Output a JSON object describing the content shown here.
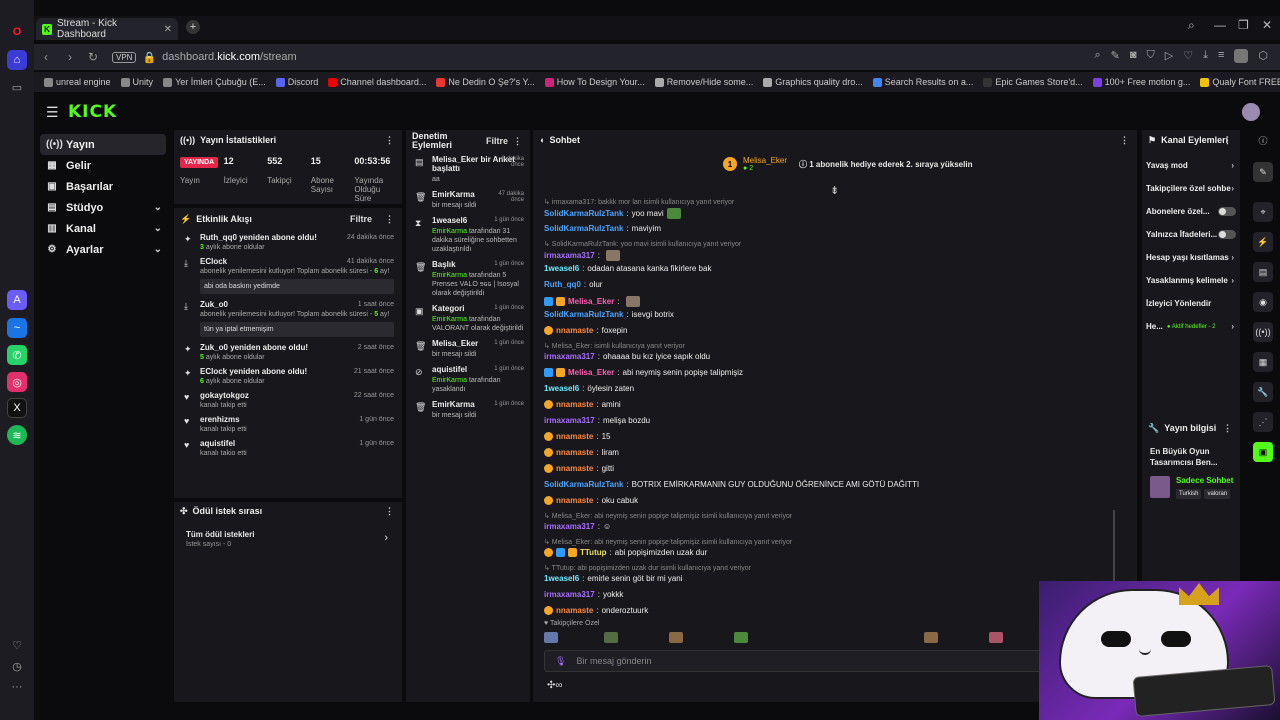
{
  "browser": {
    "tab_title": "Stream - Kick Dashboard",
    "url_host": "dashboard.",
    "url_domain": "kick.com",
    "url_path": "/stream",
    "vpn": "VPN",
    "bookmarks": [
      "unreal engine",
      "Unity",
      "Yer İmleri Çubuğu (E...",
      "Discord",
      "Channel dashboard...",
      "Ne Dedin O Şe?'s Y...",
      "How To Design Your...",
      "Remove/Hide some...",
      "Graphics quality dro...",
      "Search Results on a...",
      "Epic Games Store'd...",
      "100+ Free motion g...",
      "Qualy Font FREE Do..."
    ],
    "bookmark_colors": [
      "#888",
      "#888",
      "#888",
      "#5865f2",
      "#e00",
      "#e33",
      "#d0237a",
      "#aaa",
      "#aaa",
      "#4285f4",
      "#333",
      "#7b3fe4",
      "#f0c300"
    ]
  },
  "app": {
    "logo": "KICK",
    "nav": [
      {
        "label": "Yayın",
        "icon": "((•))",
        "active": true
      },
      {
        "label": "Gelir",
        "icon": "▦"
      },
      {
        "label": "Başarılar",
        "icon": "▣"
      },
      {
        "label": "Stüdyo",
        "icon": "▤",
        "chev": "⌄"
      },
      {
        "label": "Kanal",
        "icon": "▥",
        "chev": "⌄"
      },
      {
        "label": "Ayarlar",
        "icon": "⚙",
        "chev": "⌄"
      }
    ]
  },
  "stats": {
    "title": "Yayın İstatistikleri",
    "live": "YAYINDA",
    "items": [
      {
        "label": "Yayın",
        "value": ""
      },
      {
        "label": "İzleyici",
        "value": "12"
      },
      {
        "label": "Takipçi",
        "value": "552"
      },
      {
        "label": "Abone Sayısı",
        "value": "15"
      },
      {
        "label": "Yayında Olduğu Süre",
        "value": "00:53:56"
      }
    ]
  },
  "activity": {
    "title": "Etkinlik Akışı",
    "filter": "Filtre",
    "events": [
      {
        "title": "Ruth_qq0 yeniden abone oldu!",
        "time": "24 dakika önce",
        "sub": "3",
        "subrest": " aylık abone oldular",
        "icon": "✦"
      },
      {
        "title": "EClock",
        "time": "41 dakika önce",
        "sub2": "abonelik yenilemesini kutluyor! Toplam abonelik süresi - ",
        "subnum": "6",
        "subend": " ay!",
        "msg": "abi oda baskını yedimde",
        "icon": "⤓"
      },
      {
        "title": "Zuk_o0",
        "time": "1 saat önce",
        "sub2": "abonelik yenilemesini kutluyor! Toplam abonelik süresi - ",
        "subnum": "5",
        "subend": " ay!",
        "msg": "tün ya iptal etmemişim",
        "icon": "⤓"
      },
      {
        "title": "Zuk_o0 yeniden abone oldu!",
        "time": "2 saat önce",
        "sub": "5",
        "subrest": " aylık abone oldular",
        "icon": "✦"
      },
      {
        "title": "EClock yeniden abone oldu!",
        "time": "21 saat önce",
        "sub": "6",
        "subrest": " aylık abone oldular",
        "icon": "✦"
      },
      {
        "title": "gokaytokgoz",
        "time": "22 saat önce",
        "plain": "kanalı takip etti",
        "icon": "♥"
      },
      {
        "title": "erenhizms",
        "time": "1 gün önce",
        "plain": "kanalı takip etti",
        "icon": "♥"
      },
      {
        "title": "aquistifel",
        "time": "1 gün önce",
        "plain": "kanalı takio etti",
        "icon": "♥"
      }
    ]
  },
  "rewards": {
    "title": "Ödül istek sırası",
    "all": "Tüm ödül istekleri",
    "count": "İstek sayısı - 0"
  },
  "moderation": {
    "title": "Denetim Eylemleri",
    "filter": "Filtre",
    "items": [
      {
        "icon": "▤",
        "title": "Melisa_Eker bir Anket başlattı",
        "time": "8 dakika önce",
        "sub": "aa",
        "g": true
      },
      {
        "icon": "🗑",
        "title": "EmirKarma",
        "time": "47 dakika önce",
        "sub": "bir mesajı sildi"
      },
      {
        "icon": "⧗",
        "title": "1weasel6",
        "time": "1 gün önce",
        "gname": "EmirKarma",
        "sub": " tarafından 31 dakika süreliğine sohbetten uzaklaştırıldı"
      },
      {
        "icon": "🗑",
        "title": "Başlık",
        "time": "1 gün önce",
        "gname": "EmirKarma",
        "sub": " tarafından 5 Prenses VALO ɘɢɢ | Isosyal olarak değiştirildi"
      },
      {
        "icon": "▣",
        "title": "Kategori",
        "time": "1 gün önce",
        "gname": "EmirKarma",
        "sub": " tarafından VALORANT olarak değiştirildi"
      },
      {
        "icon": "🗑",
        "title": "Melisa_Eker",
        "time": "1 gün önce",
        "sub": "bir mesajı sildi"
      },
      {
        "icon": "⊘",
        "title": "aquistifel",
        "time": "1 gün önce",
        "gname": "EmirKarma",
        "sub": " tarafından yasaklandı"
      },
      {
        "icon": "🗑",
        "title": "EmirKarma",
        "time": "1 gün önce",
        "sub": "bir mesajı sildi"
      }
    ]
  },
  "chat": {
    "title": "Sohbet",
    "pinned_user": "Melisa_Eker",
    "pinned_count": "2",
    "pinned_text": "1 abonelik hediye ederek 2. sıraya yükselin",
    "input_placeholder": "Bir mesaj gönderin",
    "followers_label": "Takipçilere Özel",
    "lines": [
      {
        "reply": "↳ irmaxama317: bakkk mor lan isimli kullanıcıya yanıt veriyor"
      },
      {
        "user": "SolidKarmaRulzTank",
        "cls": "u2",
        "text": "yoo mavi"
      },
      {
        "user": "SolidKarmaRulzTank",
        "cls": "u2",
        "text": "maviyim"
      },
      {
        "reply": "↳ SolidKarmaRulzTank: yoo mavi  isimli kullanıcıya yanıt veriyor"
      },
      {
        "user": "irmaxama317",
        "cls": "u1",
        "text": ""
      },
      {
        "user": "1weasel6",
        "cls": "u6",
        "text": "odadan atasana kanka fikirlere bak"
      },
      {
        "user": "Ruth_qq0",
        "cls": "u2",
        "text": "olur"
      },
      {
        "user": "Melisa_Eker",
        "cls": "u4",
        "text": ""
      },
      {
        "user": "SolidKarmaRulzTank",
        "cls": "u2",
        "text": "isevgi botrix"
      },
      {
        "user": "nnamaste",
        "cls": "u3",
        "text": "foxepin"
      },
      {
        "reply": "↳ Melisa_Eker:  isimli kullanıcıya yanıt veriyor"
      },
      {
        "user": "irmaxama317",
        "cls": "u1",
        "text": "ohaaaa bu kız iyice sapık oldu"
      },
      {
        "user": "Melisa_Eker",
        "cls": "u4",
        "text": "abi neymiş senin popişe talipmişiz"
      },
      {
        "user": "1weasel6",
        "cls": "u6",
        "text": "öylesin zaten"
      },
      {
        "user": "nnamaste",
        "cls": "u3",
        "text": "amini"
      },
      {
        "user": "irmaxama317",
        "cls": "u1",
        "text": "melişa bozdu"
      },
      {
        "user": "nnamaste",
        "cls": "u3",
        "text": "15"
      },
      {
        "user": "nnamaste",
        "cls": "u3",
        "text": "liram"
      },
      {
        "user": "nnamaste",
        "cls": "u3",
        "text": "gitti"
      },
      {
        "user": "SolidKarmaRulzTank",
        "cls": "u2",
        "text": "BOTRIX EMİRKARMANIN GUY OLDUĞUNU ÖĞRENİNCE AMI GÖTÜ DAĞITTI"
      },
      {
        "user": "nnamaste",
        "cls": "u3",
        "text": "oku cabuk"
      },
      {
        "reply": "↳ Melisa_Eker: abi neymiş senin popişe talipmişiz isimli kullanıcıya yanıt veriyor"
      },
      {
        "user": "irmaxama317",
        "cls": "u1",
        "text": "☺"
      },
      {
        "reply": "↳ Melisa_Eker: abi neymiş senin popişe talipmişiz isimli kullanıcıya yanıt veriyor"
      },
      {
        "user": "TTutup",
        "cls": "u5",
        "text": "abi popişimizden uzak dur"
      },
      {
        "reply": "↳ TTutup: abi popişimizden uzak dur isimli kullanıcıya yanıt veriyor"
      },
      {
        "user": "1weasel6",
        "cls": "u6",
        "text": "emirle senin göt bir mi yani"
      },
      {
        "user": "irmaxama317",
        "cls": "u1",
        "text": "yokkk"
      },
      {
        "user": "nnamaste",
        "cls": "u3",
        "text": "onderoztuurk"
      }
    ]
  },
  "channel_actions": {
    "title": "Kanal Eylemleri",
    "items": [
      {
        "label": "Yavaş mod",
        "type": "chev"
      },
      {
        "label": "Takipçilere özel sohbe",
        "type": "chev"
      },
      {
        "label": "Abonelere özel...",
        "type": "tog"
      },
      {
        "label": "Yalnızca İfadeleri...",
        "type": "tog"
      },
      {
        "label": "Hesap yaşı kısıtlamas",
        "type": "chev"
      },
      {
        "label": "Yasaklanmış kelimele",
        "type": "chev"
      },
      {
        "label": "İzleyici Yönlendir",
        "type": "none"
      },
      {
        "label": "He...",
        "type": "chev",
        "extra": "● Aktif hedefler - 2"
      }
    ]
  },
  "stream_info": {
    "title": "Yayın bilgisi",
    "stream_title": "En Büyük Oyun Tasarımcısı Ben...",
    "mode": "Sadece Sohbet",
    "tags": [
      "Turkish",
      "valoran"
    ]
  }
}
